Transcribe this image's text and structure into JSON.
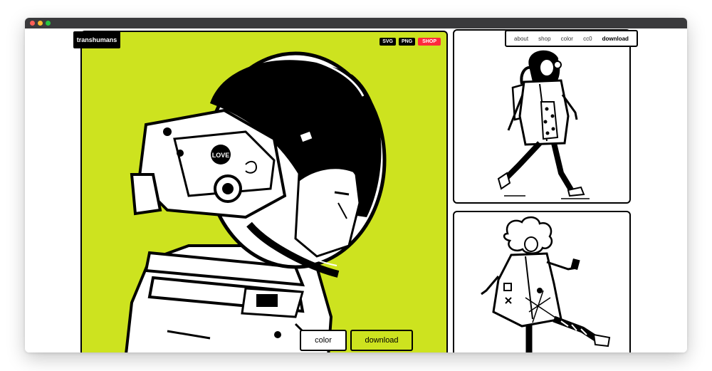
{
  "brand": {
    "label": "transhumans"
  },
  "badges": {
    "svg": "SVG",
    "png": "PNG",
    "shop": "SHOP"
  },
  "nav": {
    "about": "about",
    "shop": "shop",
    "color": "color",
    "cc0": "cc0",
    "download": "download"
  },
  "hero": {
    "sticker_text": "LOVE",
    "buttons": {
      "color": "color",
      "download": "download"
    }
  },
  "colors": {
    "accent": "#cde31f",
    "shop_badge": "#ff2a3c",
    "ink": "#000000"
  },
  "gallery": {
    "items": [
      {
        "subject": "walking-girl-with-headphones-illustration"
      },
      {
        "subject": "curly-haired-walking-figure-illustration"
      }
    ]
  }
}
